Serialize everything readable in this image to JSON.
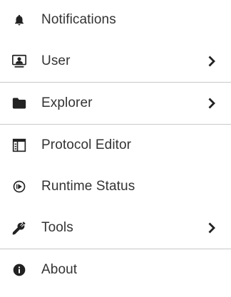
{
  "menu": {
    "items": [
      {
        "label": "Notifications",
        "icon": "bell-icon"
      },
      {
        "label": "User",
        "icon": "user-monitor-icon",
        "has_submenu": true
      },
      {
        "label": "Explorer",
        "icon": "folder-icon",
        "has_submenu": true
      },
      {
        "label": "Protocol Editor",
        "icon": "editor-window-icon"
      },
      {
        "label": "Runtime Status",
        "icon": "play-circle-icon"
      },
      {
        "label": "Tools",
        "icon": "tools-icon",
        "has_submenu": true
      },
      {
        "label": "About",
        "icon": "info-icon"
      }
    ]
  },
  "colors": {
    "text": "#333333",
    "icon": "#222222",
    "divider": "#c8c8c8",
    "background": "#ffffff"
  }
}
